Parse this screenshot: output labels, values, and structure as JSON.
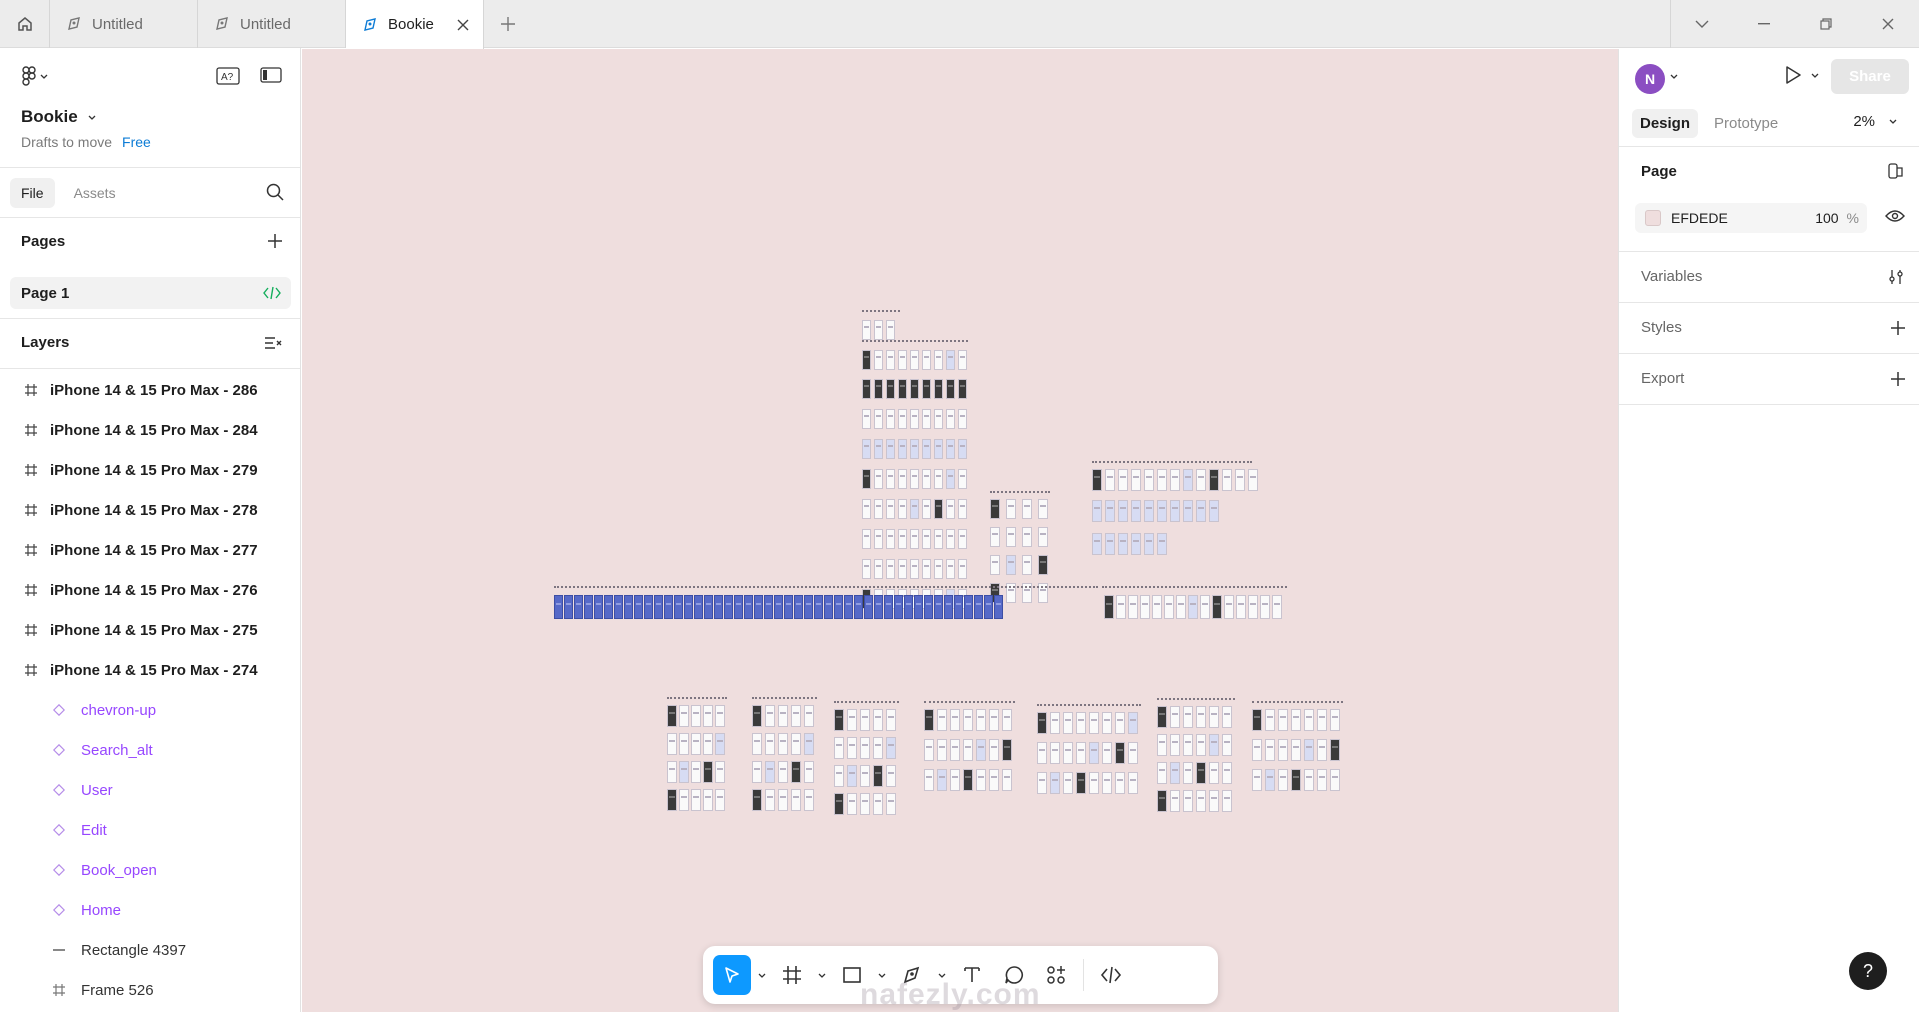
{
  "tabs": [
    {
      "label": "Untitled",
      "active": false
    },
    {
      "label": "Untitled",
      "active": false
    },
    {
      "label": "Bookie",
      "active": true
    }
  ],
  "file": {
    "name": "Bookie",
    "location": "Drafts to move",
    "plan": "Free"
  },
  "sidebar": {
    "tab_file": "File",
    "tab_assets": "Assets",
    "pages_title": "Pages",
    "current_page": "Page 1",
    "layers_title": "Layers",
    "layers": [
      {
        "name": "iPhone 14 & 15 Pro Max - 286",
        "kind": "frame"
      },
      {
        "name": "iPhone 14 & 15 Pro Max - 284",
        "kind": "frame"
      },
      {
        "name": "iPhone 14 & 15 Pro Max - 279",
        "kind": "frame"
      },
      {
        "name": "iPhone 14 & 15 Pro Max - 278",
        "kind": "frame"
      },
      {
        "name": "iPhone 14 & 15 Pro Max - 277",
        "kind": "frame"
      },
      {
        "name": "iPhone 14 & 15 Pro Max - 276",
        "kind": "frame"
      },
      {
        "name": "iPhone 14 & 15 Pro Max - 275",
        "kind": "frame"
      },
      {
        "name": "iPhone 14 & 15 Pro Max - 274",
        "kind": "frame"
      },
      {
        "name": "chevron-up",
        "kind": "component"
      },
      {
        "name": "Search_alt",
        "kind": "component"
      },
      {
        "name": "User",
        "kind": "component"
      },
      {
        "name": "Edit",
        "kind": "component"
      },
      {
        "name": "Book_open",
        "kind": "component"
      },
      {
        "name": "Home",
        "kind": "component"
      },
      {
        "name": "Rectangle 4397",
        "kind": "rectangle"
      },
      {
        "name": "Frame 526",
        "kind": "frame-small"
      }
    ]
  },
  "right_panel": {
    "avatar_initial": "N",
    "share_label": "Share",
    "tab_design": "Design",
    "tab_prototype": "Prototype",
    "zoom": "2%",
    "page_title": "Page",
    "page_fill_hex": "EFDEDE",
    "page_fill_opacity": "100",
    "page_fill_pct": "%",
    "variables": "Variables",
    "styles": "Styles",
    "export": "Export"
  },
  "canvas": {
    "background": "#EFDEDE"
  },
  "help_label": "?",
  "watermark": "nafezly.com"
}
